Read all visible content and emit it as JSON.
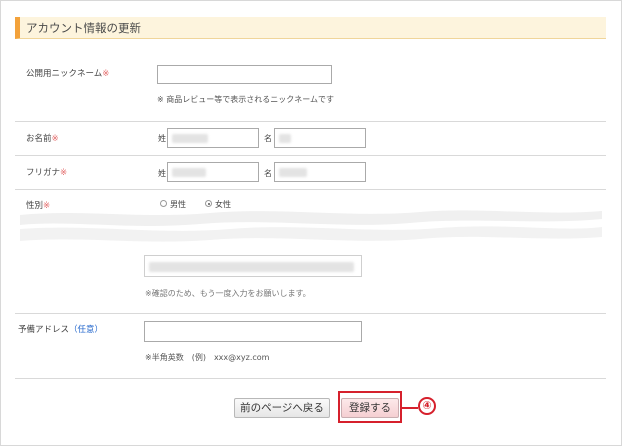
{
  "page_title": "アカウント情報の更新",
  "nickname": {
    "label": "公開用ニックネーム",
    "required_mark": "※",
    "value": "",
    "hint": "※ 商品レビュー等で表示されるニックネームです"
  },
  "name": {
    "label": "お名前",
    "required_mark": "※",
    "last_label": "姓",
    "first_label": "名"
  },
  "furigana": {
    "label": "フリガナ",
    "required_mark": "※",
    "last_label": "姓",
    "first_label": "名"
  },
  "gender": {
    "label": "性別",
    "required_mark": "※",
    "options": [
      "男性",
      "女性"
    ],
    "selected": "女性"
  },
  "email_confirm": {
    "hint": "※確認のため、もう一度入力をお願いします。"
  },
  "backup_address": {
    "label": "予備アドレス",
    "optional": "（任意）",
    "value": "",
    "hint": "※半角英数　(例)　xxx@xyz.com"
  },
  "buttons": {
    "back": "前のページへ戻る",
    "register": "登録する"
  },
  "annotation": {
    "marker": "④",
    "color": "#d6202c"
  }
}
